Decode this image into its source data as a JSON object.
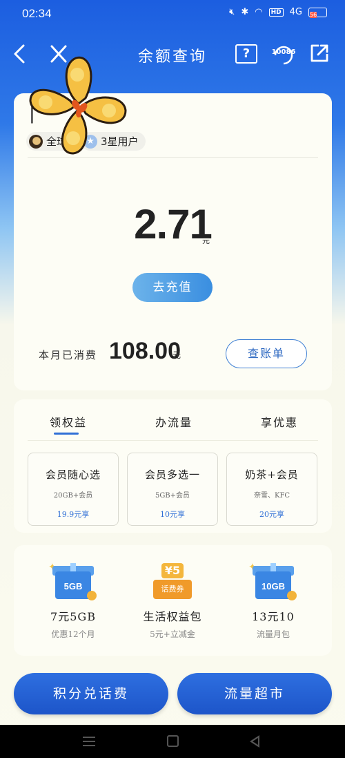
{
  "status_bar": {
    "time": "02:34",
    "hd": "HD",
    "signal": "4G",
    "battery": "56"
  },
  "nav": {
    "title": "余额查询",
    "help_glyph": "?",
    "service_number": "10086",
    "icons": [
      "back-icon",
      "close-icon",
      "help-icon",
      "customer-service-icon",
      "share-icon"
    ]
  },
  "account": {
    "name_visible": "|‘",
    "tags": [
      {
        "label": "全球",
        "icon": "brand-icon"
      },
      {
        "label": "3星用户",
        "icon": "star-icon"
      }
    ]
  },
  "balance": {
    "amount": "2.71",
    "unit": "元",
    "recharge_label": "去充值",
    "spent_label": "本月已消费",
    "spent_amount": "108.00",
    "spent_unit": "元",
    "bill_label": "查账单"
  },
  "benefits": {
    "tabs": [
      {
        "label": "领权益",
        "active": true
      },
      {
        "label": "办流量",
        "active": false
      },
      {
        "label": "享优惠",
        "active": false
      }
    ],
    "offers": [
      {
        "title": "会员随心选",
        "desc": "20GB+会员",
        "price": "19.9元享"
      },
      {
        "title": "会员多选一",
        "desc": "5GB+会员",
        "price": "10元享"
      },
      {
        "title": "奶茶+会员",
        "desc": "奈雪、KFC",
        "price": "20元享"
      }
    ]
  },
  "products": [
    {
      "badge": "5GB",
      "name": "7元5GB",
      "desc": "优惠12个月",
      "icon": "gift-box-icon"
    },
    {
      "badge": "¥5",
      "badge_sub": "话费券",
      "name": "生活权益包",
      "desc": "5元+立减金",
      "icon": "coupon-icon"
    },
    {
      "badge": "10GB",
      "name": "13元10",
      "desc": "流量月包",
      "icon": "gift-box-icon"
    }
  ],
  "bottom_buttons": {
    "points_label": "积分兑话费",
    "traffic_label": "流量超市"
  },
  "colors": {
    "primary": "#1d55c9",
    "accent": "#2f6fd6",
    "card": "#fdfdf5",
    "battery": "#ff5a4a"
  }
}
